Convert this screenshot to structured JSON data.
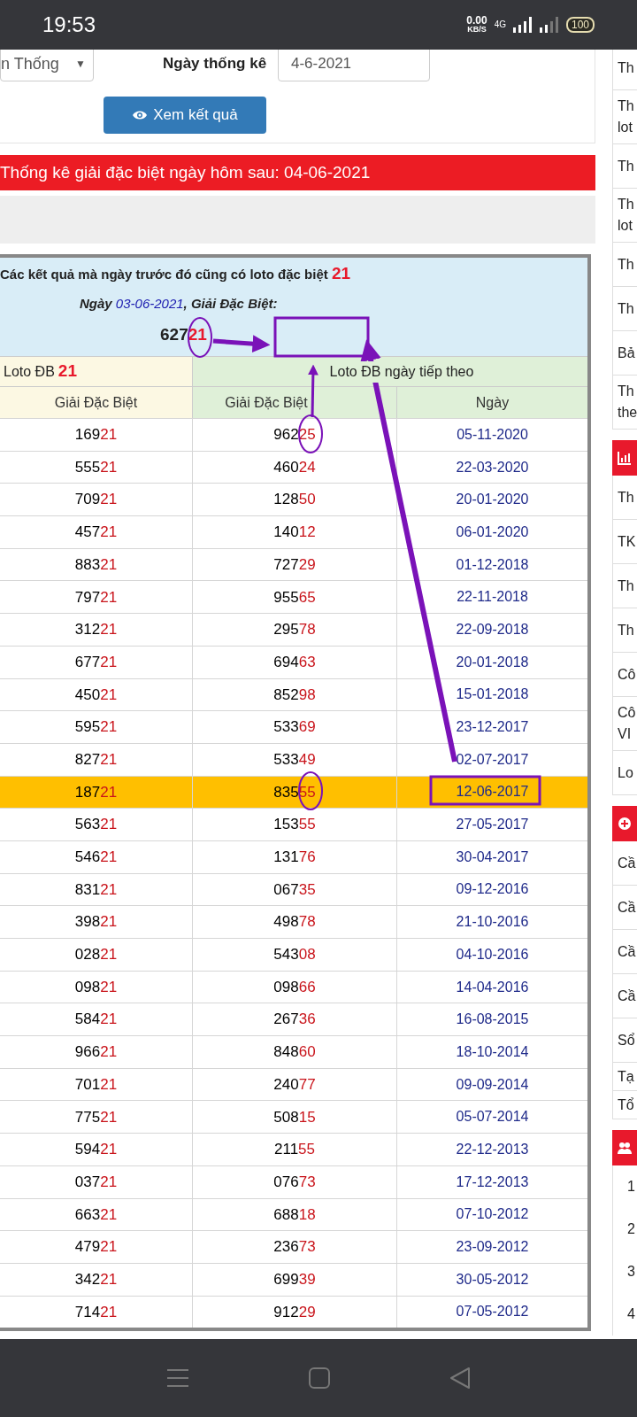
{
  "status_bar": {
    "time": "19:53",
    "speed": "0.00",
    "speed_unit": "KB/S",
    "network": "4G",
    "battery": "100"
  },
  "form": {
    "select_value": "n Thống",
    "select_caret": "▼",
    "date_label": "Ngày thống kê",
    "date_value": "4-6-2021",
    "button": "Xem kết quả"
  },
  "banner": "Thống kê giải đặc biệt ngày hôm sau: 04-06-2021",
  "result": {
    "title": "Các kết quả mà ngày trước đó cũng có loto đặc biệt",
    "title_number": "21",
    "day_label": "Ngày",
    "day": "03-06-2021",
    "special_label": ", Giải Đặc Biệt:",
    "special": "62721"
  },
  "table": {
    "group_1": "Loto ĐB",
    "group_1_number": "21",
    "group_2": "Loto ĐB ngày tiếp theo",
    "columns": [
      "Giải Đặc Biệt",
      "Giải Đặc Biệt",
      "Ngày"
    ],
    "rows": [
      {
        "special": "16921",
        "next": "96225",
        "date": "05-11-2020",
        "selected": false
      },
      {
        "special": "55521",
        "next": "46024",
        "date": "22-03-2020",
        "selected": false
      },
      {
        "special": "70921",
        "next": "12850",
        "date": "20-01-2020",
        "selected": false
      },
      {
        "special": "45721",
        "next": "14012",
        "date": "06-01-2020",
        "selected": false
      },
      {
        "special": "88321",
        "next": "72729",
        "date": "01-12-2018",
        "selected": false
      },
      {
        "special": "79721",
        "next": "95565",
        "date": "22-11-2018",
        "selected": false
      },
      {
        "special": "31221",
        "next": "29578",
        "date": "22-09-2018",
        "selected": false
      },
      {
        "special": "67721",
        "next": "69463",
        "date": "20-01-2018",
        "selected": false
      },
      {
        "special": "45021",
        "next": "85298",
        "date": "15-01-2018",
        "selected": false
      },
      {
        "special": "59521",
        "next": "53369",
        "date": "23-12-2017",
        "selected": false
      },
      {
        "special": "82721",
        "next": "53349",
        "date": "02-07-2017",
        "selected": false
      },
      {
        "special": "18721",
        "next": "83555",
        "date": "12-06-2017",
        "selected": true
      },
      {
        "special": "56321",
        "next": "15355",
        "date": "27-05-2017",
        "selected": false
      },
      {
        "special": "54621",
        "next": "13176",
        "date": "30-04-2017",
        "selected": false
      },
      {
        "special": "83121",
        "next": "06735",
        "date": "09-12-2016",
        "selected": false
      },
      {
        "special": "39821",
        "next": "49878",
        "date": "21-10-2016",
        "selected": false
      },
      {
        "special": "02821",
        "next": "54308",
        "date": "04-10-2016",
        "selected": false
      },
      {
        "special": "09821",
        "next": "09866",
        "date": "14-04-2016",
        "selected": false
      },
      {
        "special": "58421",
        "next": "26736",
        "date": "16-08-2015",
        "selected": false
      },
      {
        "special": "96621",
        "next": "84860",
        "date": "18-10-2014",
        "selected": false
      },
      {
        "special": "70121",
        "next": "24077",
        "date": "09-09-2014",
        "selected": false
      },
      {
        "special": "77521",
        "next": "50815",
        "date": "05-07-2014",
        "selected": false
      },
      {
        "special": "59421",
        "next": "21155",
        "date": "22-12-2013",
        "selected": false
      },
      {
        "special": "03721",
        "next": "07673",
        "date": "17-12-2013",
        "selected": false
      },
      {
        "special": "66321",
        "next": "68818",
        "date": "07-10-2012",
        "selected": false
      },
      {
        "special": "47921",
        "next": "23673",
        "date": "23-09-2012",
        "selected": false
      },
      {
        "special": "34221",
        "next": "69939",
        "date": "30-05-2012",
        "selected": false
      },
      {
        "special": "71421",
        "next": "91229",
        "date": "07-05-2012",
        "selected": false
      }
    ]
  },
  "sidebar": {
    "groups": [
      {
        "items": [
          {
            "lines": [
              "Th"
            ]
          },
          {
            "lines": [
              "Th",
              "lot"
            ]
          },
          {
            "lines": [
              "Th"
            ]
          },
          {
            "lines": [
              "Th",
              "lot"
            ]
          },
          {
            "lines": [
              "Th"
            ]
          },
          {
            "lines": [
              "Th"
            ]
          },
          {
            "lines": [
              "Bả"
            ]
          },
          {
            "lines": [
              "Th",
              "the"
            ]
          }
        ]
      },
      {
        "items": [
          {
            "lines": [
              "Th"
            ]
          },
          {
            "lines": [
              "TK"
            ]
          },
          {
            "lines": [
              "Th"
            ]
          },
          {
            "lines": [
              "Th"
            ]
          },
          {
            "lines": [
              "Cô"
            ]
          },
          {
            "lines": [
              "Cô",
              "VI"
            ]
          },
          {
            "lines": [
              "Lo"
            ]
          }
        ]
      },
      {
        "items": [
          {
            "lines": [
              "Cầ"
            ]
          },
          {
            "lines": [
              "Cầ"
            ]
          },
          {
            "lines": [
              "Cầ"
            ]
          },
          {
            "lines": [
              "Cầ"
            ]
          },
          {
            "lines": [
              "Sổ"
            ]
          },
          {
            "lines": [
              "Tạ"
            ]
          },
          {
            "lines": [
              "Tổ"
            ]
          }
        ]
      },
      {
        "items": [
          {
            "lines": [
              "1"
            ]
          },
          {
            "lines": [
              "2"
            ]
          },
          {
            "lines": [
              "3"
            ]
          },
          {
            "lines": [
              "4"
            ]
          }
        ]
      }
    ]
  }
}
